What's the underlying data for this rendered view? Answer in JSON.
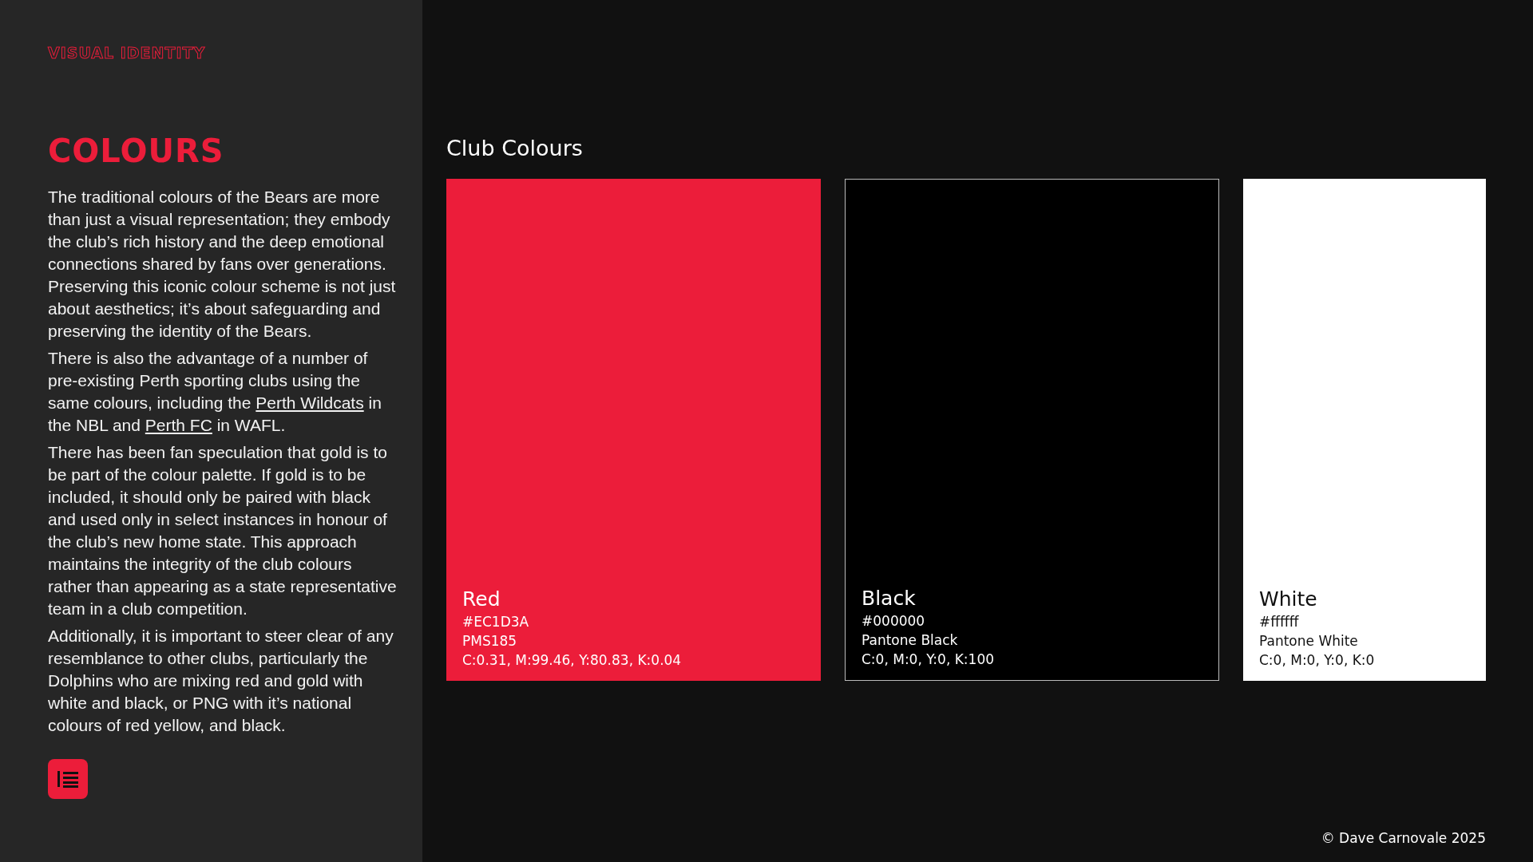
{
  "sidebar": {
    "eyebrow": "VISUAL IDENTITY",
    "title": "COLOURS",
    "paragraphs": [
      [
        {
          "text": "The traditional colours of the Bears are more than just a visual representation; they embody the club’s rich history and the deep emotional connections shared by fans over generations. Preserving this iconic colour scheme is not just about aesthetics; it’s about safeguarding and preserving the identity of the Bears."
        }
      ],
      [
        {
          "text": "There is also the advantage of a number of pre-existing Perth sporting clubs using the same colours, including the "
        },
        {
          "link": "Perth Wildcats"
        },
        {
          "text": " in the NBL and "
        },
        {
          "link": "Perth FC"
        },
        {
          "text": " in WAFL."
        }
      ],
      [
        {
          "text": "There has been fan speculation that gold is to be part of the colour palette. If gold is to be included, it should only be paired with black and used only in select instances in honour of the club’s new home state. This approach maintains the integrity of the club colours rather than appearing as a state representative team in a club competition."
        }
      ],
      [
        {
          "text": "Additionally, it is important to steer clear of any resemblance to other clubs, particularly the Dolphins who are mixing red and gold with white and black, or PNG with it’s national colours of red yellow, and black."
        }
      ]
    ]
  },
  "main": {
    "heading": "Club Colours",
    "swatches": [
      {
        "name": "Red",
        "color": "#ec1d3a",
        "lines": [
          "#EC1D3A",
          "PMS185",
          "C:0.31, M:99.46, Y:80.83, K:0.04"
        ]
      },
      {
        "name": "Black",
        "color": "#000000",
        "lines": [
          "#000000",
          "Pantone Black",
          "C:0, M:0, Y:0, K:100"
        ]
      },
      {
        "name": "White",
        "color": "#ffffff",
        "lines": [
          "#ffffff",
          "Pantone White",
          "C:0, M:0, Y:0, K:0"
        ]
      }
    ],
    "footer": "© Dave Carnovale 2025"
  }
}
